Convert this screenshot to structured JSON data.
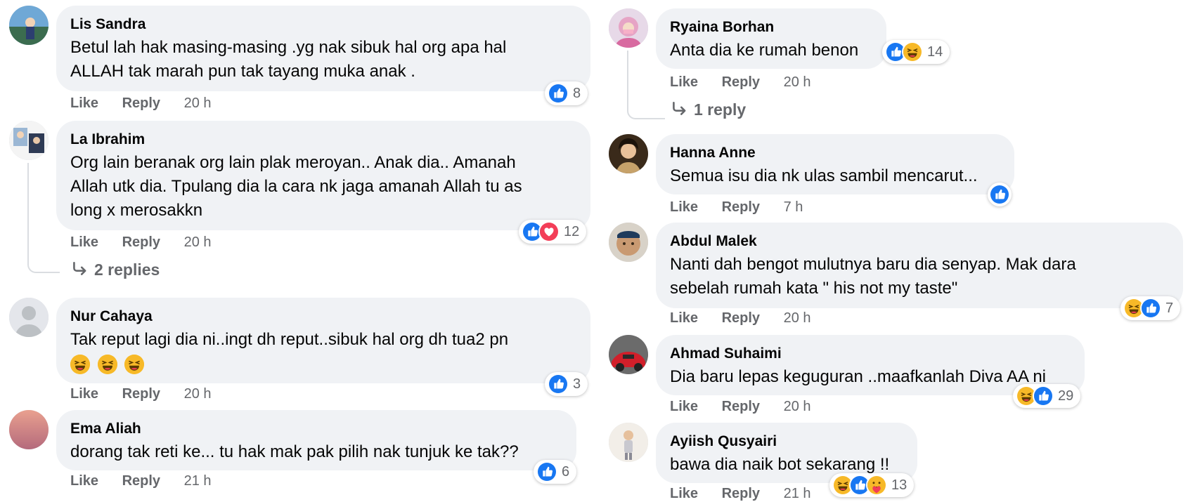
{
  "labels": {
    "like": "Like",
    "reply": "Reply"
  },
  "colors": {
    "like_blue": "#1877f2",
    "love_red": "#f33e58",
    "haha_yellow": "#f7b928",
    "bubble_bg": "#f0f2f5",
    "meta_grey": "#65676b"
  },
  "left": [
    {
      "author": "Lis Sandra",
      "lines": [
        "Betul lah hak masing-masing .yg nak sibuk hal org apa hal",
        "ALLAH tak marah pun tak tayang muka anak ."
      ],
      "time": "20 h",
      "reactions": [
        "like"
      ],
      "count": "8"
    },
    {
      "author": "La Ibrahim",
      "lines": [
        "Org lain beranak org lain plak meroyan.. Anak dia.. Amanah",
        "Allah utk dia. Tpulang dia la cara nk jaga amanah Allah tu as",
        "long x merosakkn"
      ],
      "time": "20 h",
      "reactions": [
        "like",
        "love"
      ],
      "count": "12",
      "replies": "2 replies"
    },
    {
      "author": "Nur Cahaya",
      "lines": [
        "Tak reput lagi dia ni..ingt dh reput..sibuk hal org dh tua2 pn"
      ],
      "emojis": [
        "rolling-laughing-emoji",
        "rolling-laughing-emoji",
        "rolling-laughing-emoji"
      ],
      "time": "20 h",
      "reactions": [
        "like"
      ],
      "count": "3"
    },
    {
      "author": "Ema Aliah",
      "lines": [
        "dorang tak reti ke... tu hak mak pak pilih nak tunjuk ke tak??"
      ],
      "time": "21 h",
      "reactions": [
        "like"
      ],
      "count": "6"
    }
  ],
  "right": [
    {
      "author": "Ryaina Borhan",
      "lines": [
        "Anta dia ke rumah benon"
      ],
      "time": "20 h",
      "reactions": [
        "like",
        "haha"
      ],
      "count": "14",
      "replies": "1 reply"
    },
    {
      "author": "Hanna Anne",
      "lines": [
        "Semua isu dia nk ulas sambil mencarut..."
      ],
      "time": "7 h",
      "reactions": [
        "like"
      ],
      "count": ""
    },
    {
      "author": "Abdul Malek",
      "lines": [
        "Nanti dah bengot mulutnya baru dia senyap. Mak dara",
        "sebelah rumah kata \" his not my taste\""
      ],
      "time": "20 h",
      "reactions": [
        "haha",
        "like"
      ],
      "count": "7"
    },
    {
      "author": "Ahmad Suhaimi",
      "lines": [
        "Dia baru lepas keguguran ..maafkanlah Diva AA ni"
      ],
      "time": "20 h",
      "reactions": [
        "haha",
        "like"
      ],
      "count": "29"
    },
    {
      "author": "Ayiish Qusyairi",
      "lines": [
        "bawa dia naik bot sekarang !!"
      ],
      "time": "21 h",
      "reactions": [
        "haha",
        "like",
        "care"
      ],
      "count": "13"
    }
  ]
}
